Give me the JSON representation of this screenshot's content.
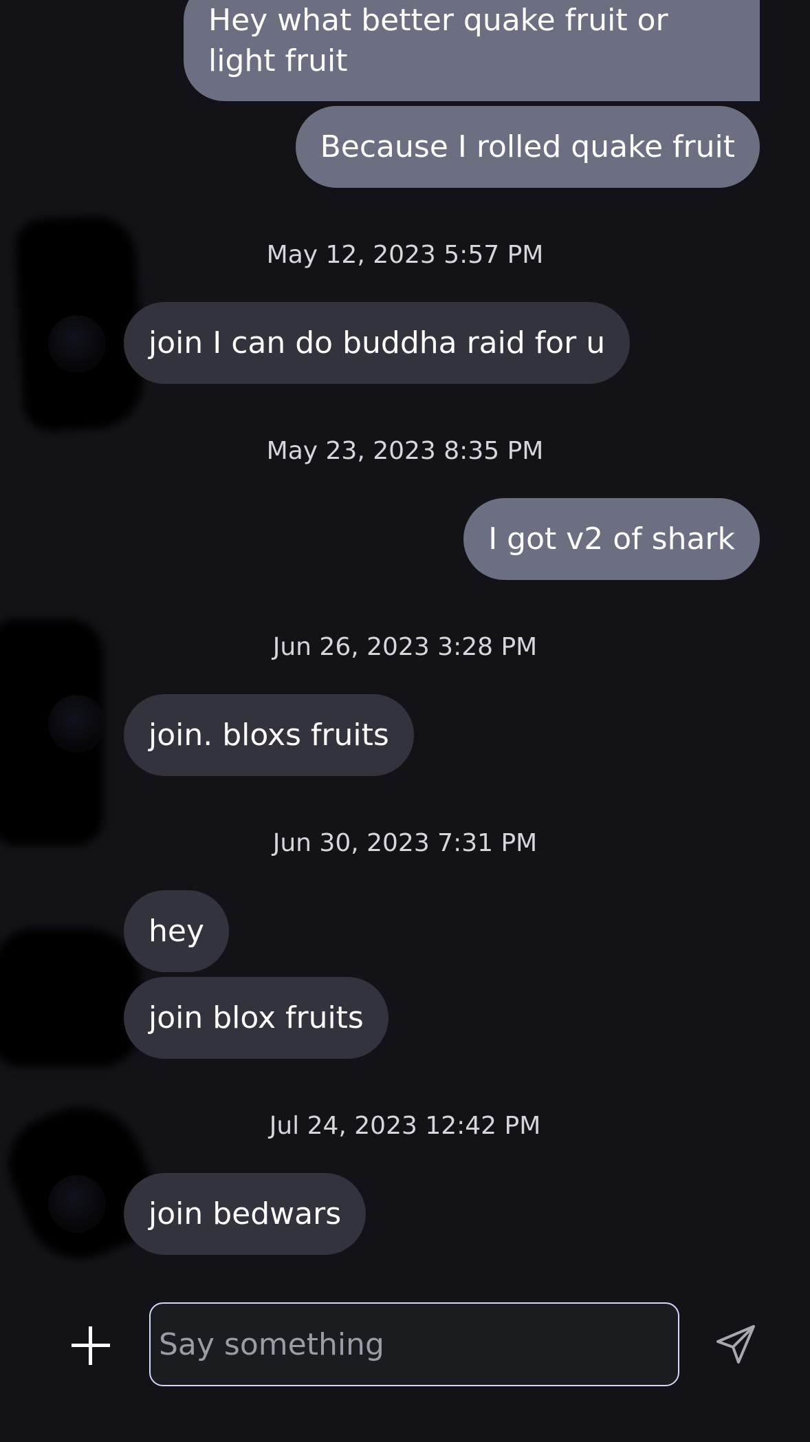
{
  "conversation": {
    "messages": [
      {
        "sender": "me",
        "text": "Hey what better quake fruit or light fruit"
      },
      {
        "sender": "me",
        "text": "Because I rolled quake fruit"
      },
      {
        "timestamp": "May 12, 2023 5:57 PM"
      },
      {
        "sender": "them",
        "text": "join I can do buddha raid for u"
      },
      {
        "timestamp": "May 23, 2023 8:35 PM"
      },
      {
        "sender": "me",
        "text": "I got v2 of shark"
      },
      {
        "timestamp": "Jun 26, 2023 3:28 PM"
      },
      {
        "sender": "them",
        "text": "join. bloxs fruits"
      },
      {
        "timestamp": "Jun 30, 2023 7:31 PM"
      },
      {
        "sender": "them",
        "text": "hey"
      },
      {
        "sender": "them",
        "text": "join blox fruits"
      },
      {
        "timestamp": "Jul 24, 2023 12:42 PM"
      },
      {
        "sender": "them",
        "text": "join bedwars"
      }
    ]
  },
  "composer": {
    "add_icon": "plus-icon",
    "placeholder": "Say something",
    "send_icon": "paper-plane-icon"
  },
  "colors": {
    "background": "#121217",
    "my_bubble": "#6c6e81",
    "their_bubble": "#33333d",
    "input_border": "#d3d6ff"
  }
}
